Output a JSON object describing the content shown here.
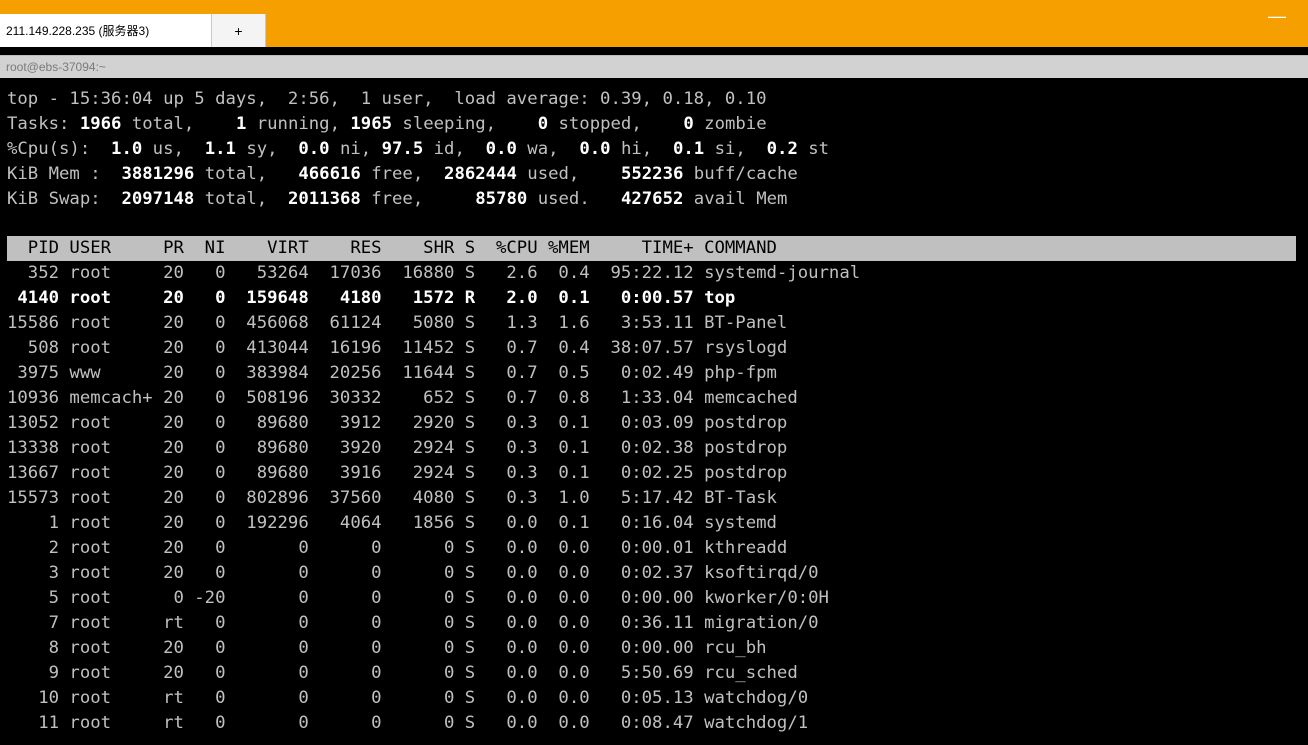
{
  "window": {
    "tab_title": "211.149.228.235 (服务器3)",
    "tab_add": "+",
    "minimize": "—",
    "session_title": "root@ebs-37094:~"
  },
  "colors": {
    "titlebar": "#f5a000",
    "terminal_bg": "#000000",
    "terminal_fg": "#c0c0c0",
    "header_bg": "#c0c0c0"
  },
  "top": {
    "uptime": "top - 15:36:04 up 5 days,  2:56,  1 user,  load average: 0.39, 0.18, 0.10",
    "tasks": {
      "label": "Tasks:",
      "total": "1966",
      "total_l": "total,",
      "running": "1",
      "running_l": "running,",
      "sleeping": "1965",
      "sleeping_l": "sleeping,",
      "stopped": "0",
      "stopped_l": "stopped,",
      "zombie": "0",
      "zombie_l": "zombie"
    },
    "cpu": {
      "label": "%Cpu(s):",
      "us": "1.0",
      "us_l": "us,",
      "sy": "1.1",
      "sy_l": "sy,",
      "ni": "0.0",
      "ni_l": "ni,",
      "id": "97.5",
      "id_l": "id,",
      "wa": "0.0",
      "wa_l": "wa,",
      "hi": "0.0",
      "hi_l": "hi,",
      "si": "0.1",
      "si_l": "si,",
      "st": "0.2",
      "st_l": "st"
    },
    "mem": {
      "label": "KiB Mem :",
      "total": "3881296",
      "total_l": "total,",
      "free": "466616",
      "free_l": "free,",
      "used": "2862444",
      "used_l": "used,",
      "cache": "552236",
      "cache_l": "buff/cache"
    },
    "swap": {
      "label": "KiB Swap:",
      "total": "2097148",
      "total_l": "total,",
      "free": "2011368",
      "free_l": "free,",
      "used": "85780",
      "used_l": "used.",
      "avail": "427652",
      "avail_l": "avail Mem"
    },
    "columns": [
      "PID",
      "USER",
      "PR",
      "NI",
      "VIRT",
      "RES",
      "SHR",
      "S",
      "%CPU",
      "%MEM",
      "TIME+",
      "COMMAND"
    ],
    "processes": [
      [
        "352",
        "root",
        "20",
        "0",
        "53264",
        "17036",
        "16880",
        "S",
        "2.6",
        "0.4",
        "95:22.12",
        "systemd-journal"
      ],
      [
        "4140",
        "root",
        "20",
        "0",
        "159648",
        "4180",
        "1572",
        "R",
        "2.0",
        "0.1",
        "0:00.57",
        "top"
      ],
      [
        "15586",
        "root",
        "20",
        "0",
        "456068",
        "61124",
        "5080",
        "S",
        "1.3",
        "1.6",
        "3:53.11",
        "BT-Panel"
      ],
      [
        "508",
        "root",
        "20",
        "0",
        "413044",
        "16196",
        "11452",
        "S",
        "0.7",
        "0.4",
        "38:07.57",
        "rsyslogd"
      ],
      [
        "3975",
        "www",
        "20",
        "0",
        "383984",
        "20256",
        "11644",
        "S",
        "0.7",
        "0.5",
        "0:02.49",
        "php-fpm"
      ],
      [
        "10936",
        "memcach+",
        "20",
        "0",
        "508196",
        "30332",
        "652",
        "S",
        "0.7",
        "0.8",
        "1:33.04",
        "memcached"
      ],
      [
        "13052",
        "root",
        "20",
        "0",
        "89680",
        "3912",
        "2920",
        "S",
        "0.3",
        "0.1",
        "0:03.09",
        "postdrop"
      ],
      [
        "13338",
        "root",
        "20",
        "0",
        "89680",
        "3920",
        "2924",
        "S",
        "0.3",
        "0.1",
        "0:02.38",
        "postdrop"
      ],
      [
        "13667",
        "root",
        "20",
        "0",
        "89680",
        "3916",
        "2924",
        "S",
        "0.3",
        "0.1",
        "0:02.25",
        "postdrop"
      ],
      [
        "15573",
        "root",
        "20",
        "0",
        "802896",
        "37560",
        "4080",
        "S",
        "0.3",
        "1.0",
        "5:17.42",
        "BT-Task"
      ],
      [
        "1",
        "root",
        "20",
        "0",
        "192296",
        "4064",
        "1856",
        "S",
        "0.0",
        "0.1",
        "0:16.04",
        "systemd"
      ],
      [
        "2",
        "root",
        "20",
        "0",
        "0",
        "0",
        "0",
        "S",
        "0.0",
        "0.0",
        "0:00.01",
        "kthreadd"
      ],
      [
        "3",
        "root",
        "20",
        "0",
        "0",
        "0",
        "0",
        "S",
        "0.0",
        "0.0",
        "0:02.37",
        "ksoftirqd/0"
      ],
      [
        "5",
        "root",
        "0",
        "-20",
        "0",
        "0",
        "0",
        "S",
        "0.0",
        "0.0",
        "0:00.00",
        "kworker/0:0H"
      ],
      [
        "7",
        "root",
        "rt",
        "0",
        "0",
        "0",
        "0",
        "S",
        "0.0",
        "0.0",
        "0:36.11",
        "migration/0"
      ],
      [
        "8",
        "root",
        "20",
        "0",
        "0",
        "0",
        "0",
        "S",
        "0.0",
        "0.0",
        "0:00.00",
        "rcu_bh"
      ],
      [
        "9",
        "root",
        "20",
        "0",
        "0",
        "0",
        "0",
        "S",
        "0.0",
        "0.0",
        "5:50.69",
        "rcu_sched"
      ],
      [
        "10",
        "root",
        "rt",
        "0",
        "0",
        "0",
        "0",
        "S",
        "0.0",
        "0.0",
        "0:05.13",
        "watchdog/0"
      ],
      [
        "11",
        "root",
        "rt",
        "0",
        "0",
        "0",
        "0",
        "S",
        "0.0",
        "0.0",
        "0:08.47",
        "watchdog/1"
      ]
    ]
  }
}
